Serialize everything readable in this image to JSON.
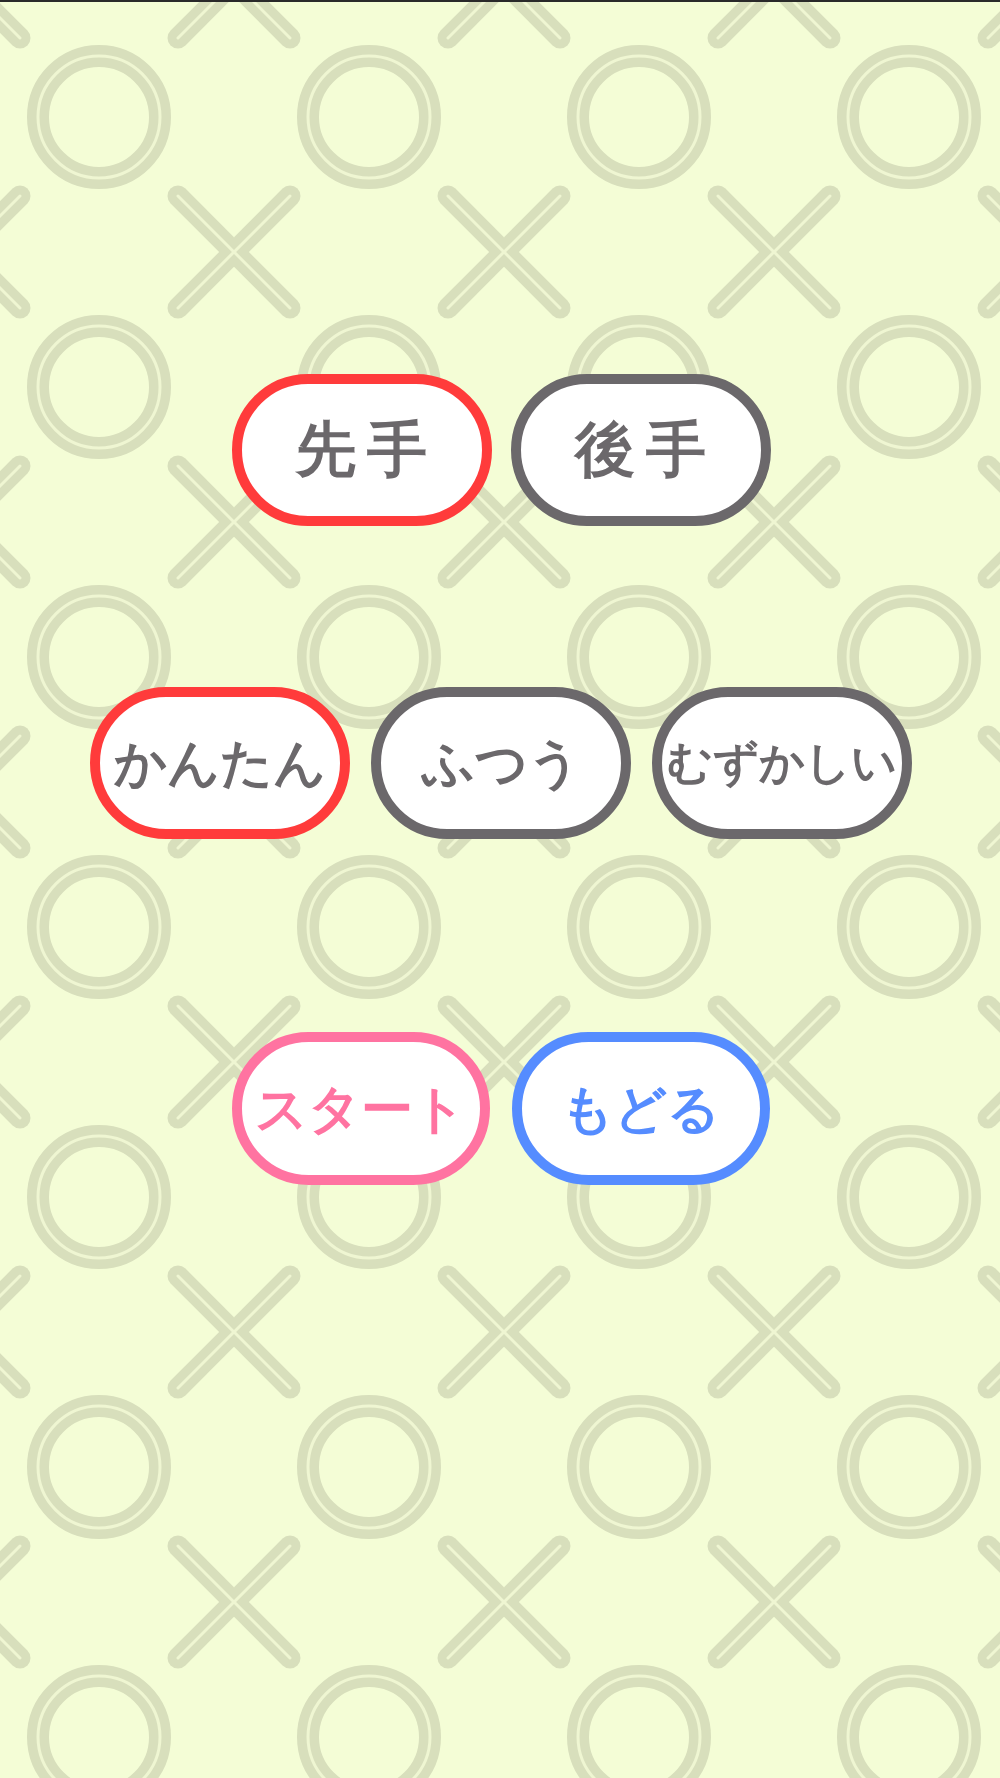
{
  "turn_options": [
    {
      "label": "先手",
      "selected": true
    },
    {
      "label": "後手",
      "selected": false
    }
  ],
  "difficulty_options": [
    {
      "label": "かんたん",
      "selected": true
    },
    {
      "label": "ふつう",
      "selected": false
    },
    {
      "label": "むずかしい",
      "selected": false
    }
  ],
  "actions": [
    {
      "label": "スタート",
      "kind": "start"
    },
    {
      "label": "もどる",
      "kind": "back"
    }
  ]
}
